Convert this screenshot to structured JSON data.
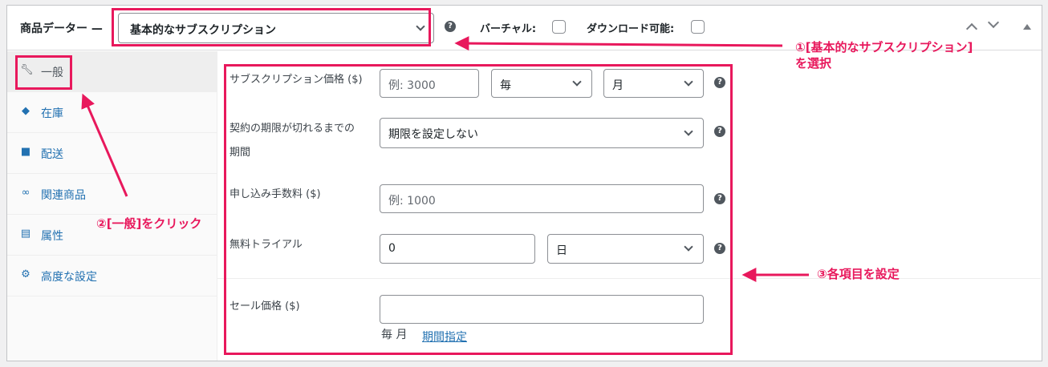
{
  "header": {
    "title": "商品データー —",
    "product_type": "基本的なサブスクリプション",
    "virtual_label": "バーチャル:",
    "downloadable_label": "ダウンロード可能:"
  },
  "tabs": [
    {
      "label": "一般",
      "icon": "wrench-icon",
      "active": true
    },
    {
      "label": "在庫",
      "icon": "tag-icon"
    },
    {
      "label": "配送",
      "icon": "truck-icon"
    },
    {
      "label": "関連商品",
      "icon": "link-icon"
    },
    {
      "label": "属性",
      "icon": "list-icon"
    },
    {
      "label": "高度な設定",
      "icon": "gear-icon"
    }
  ],
  "fields": {
    "price_label": "サブスクリプション価格 ($)",
    "price_placeholder": "例: 3000",
    "interval_value": "毎",
    "period_value": "月",
    "expire_label_1": "契約の期限が切れるまでの",
    "expire_label_2": "期間",
    "expire_value": "期限を設定しない",
    "signup_fee_label": "申し込み手数料 ($)",
    "signup_fee_placeholder": "例: 1000",
    "trial_label": "無料トライアル",
    "trial_length_value": "0",
    "trial_period_value": "日",
    "sale_price_label": "セール価格 ($)",
    "sale_price_value": "",
    "sale_period_text": "毎 月",
    "schedule_link": "期間指定"
  },
  "annotations": {
    "step1_line1": "①[基本的なサブスクリプション]",
    "step1_line2": "を選択",
    "step2": "②[一般]をクリック",
    "step3": "③各項目を設定"
  },
  "colors": {
    "accent": "#e8185c",
    "link": "#2271b1"
  }
}
